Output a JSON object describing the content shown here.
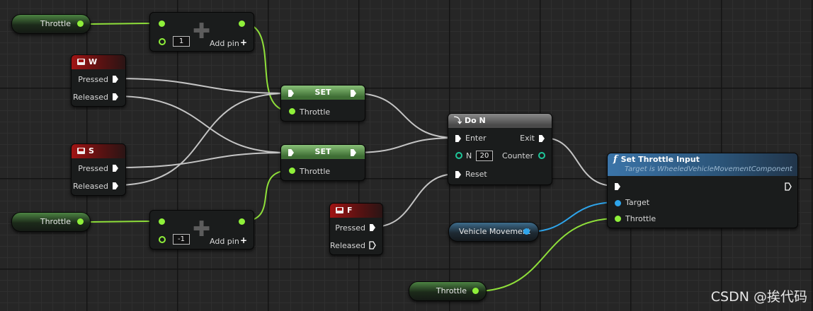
{
  "colors": {
    "float_pin": "#8ff03a",
    "object_pin": "#2ea4ea",
    "int_pin": "#1fc79a",
    "exec_pin": "#ffffff",
    "wire_exec": "#c9c9c9"
  },
  "throttle_get_top": {
    "label": "Throttle"
  },
  "add_top": {
    "value": "1",
    "add_pin_label": "Add pin"
  },
  "key_w": {
    "title": "W",
    "pressed": "Pressed",
    "released": "Released"
  },
  "set_top": {
    "title": "SET",
    "pin": "Throttle"
  },
  "set_bottom": {
    "title": "SET",
    "pin": "Throttle"
  },
  "key_s": {
    "title": "S",
    "pressed": "Pressed",
    "released": "Released"
  },
  "throttle_get_bottom": {
    "label": "Throttle"
  },
  "add_bottom": {
    "value": "-1",
    "add_pin_label": "Add pin"
  },
  "do_n": {
    "title": "Do N",
    "enter": "Enter",
    "exit": "Exit",
    "n_label": "N",
    "n_value": "20",
    "counter": "Counter",
    "reset": "Reset"
  },
  "key_f": {
    "title": "F",
    "pressed": "Pressed",
    "released": "Released"
  },
  "vehicle_movement": {
    "label": "Vehicle Movement"
  },
  "set_throttle_input": {
    "title": "Set Throttle Input",
    "subtitle": "Target is WheeledVehicleMovementComponent",
    "target": "Target",
    "throttle": "Throttle"
  },
  "throttle_get_right": {
    "label": "Throttle"
  },
  "watermark": "CSDN @挨代码"
}
